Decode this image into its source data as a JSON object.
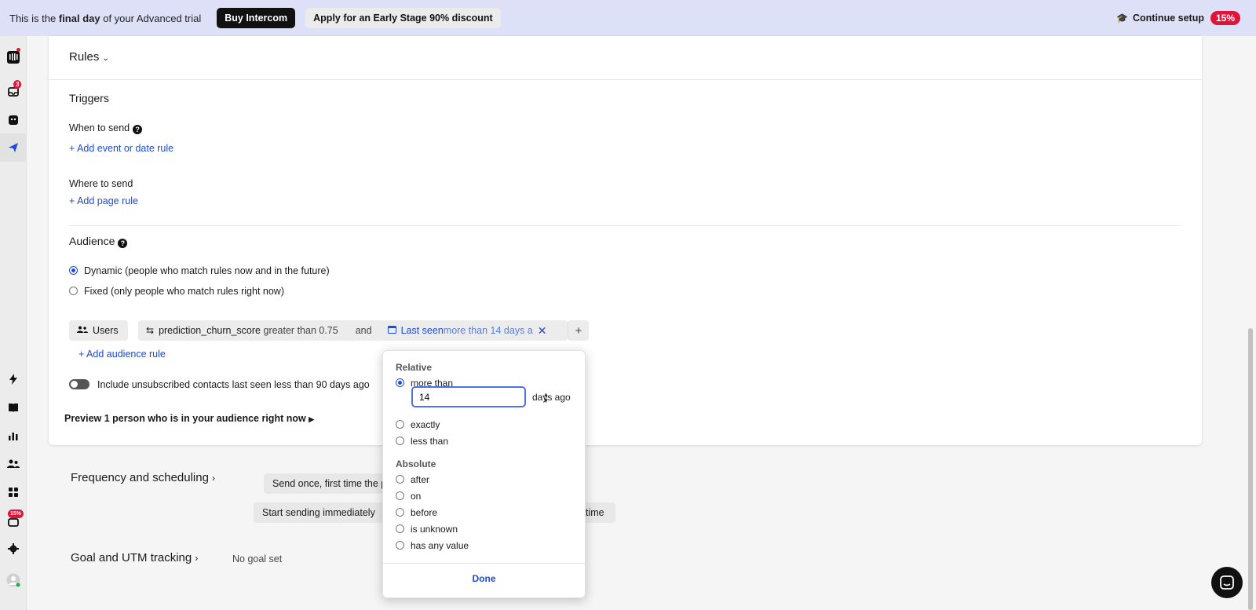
{
  "banner": {
    "msg_prefix": "This is the ",
    "msg_bold": "final day",
    "msg_suffix": " of your Advanced trial",
    "buy_label": "Buy Intercom",
    "discount_label": "Apply for an Early Stage 90% discount",
    "continue_label": "Continue setup",
    "progress_badge": "15%"
  },
  "sidebar": {
    "inbox_badge": "3",
    "setup_badge": "15%"
  },
  "rules": {
    "title": "Rules"
  },
  "triggers": {
    "title": "Triggers",
    "when_label": "When to send",
    "add_event_label": "Add event or date rule",
    "where_label": "Where to send",
    "add_page_label": "Add page rule"
  },
  "audience": {
    "title": "Audience",
    "dynamic_label": "Dynamic (people who match rules now and in the future)",
    "fixed_label": "Fixed (only people who match rules right now)",
    "users_chip": "Users",
    "rule1_attr": "prediction_churn_score",
    "rule1_cond": " greater than 0.75",
    "and_label": "and",
    "rule2_attr": "Last seen",
    "rule2_cond": " more than 14 days a",
    "add_rule_label": "Add audience rule",
    "unsub_label": "Include unsubscribed contacts last seen less than 90 days ago",
    "preview_label": "Preview 1 person who is in your audience right now"
  },
  "popover": {
    "relative_heading": "Relative",
    "more_than": "more than",
    "input_value": "14",
    "days_ago": "days ago",
    "exactly": "exactly",
    "less_than": "less than",
    "absolute_heading": "Absolute",
    "after": "after",
    "on": "on",
    "before": "before",
    "is_unknown": "is unknown",
    "has_any_value": "has any value",
    "done_label": "Done"
  },
  "frequency": {
    "title": "Frequency and scheduling",
    "send_once": "Send once, first time the p",
    "start_sending": "Start sending immediately",
    "time_frag": "time"
  },
  "goal": {
    "title": "Goal and UTM tracking",
    "no_goal": "No goal set"
  },
  "colors": {
    "accent": "#1c4bd6",
    "banner_bg": "#dde0f7",
    "badge": "#e0143b"
  }
}
